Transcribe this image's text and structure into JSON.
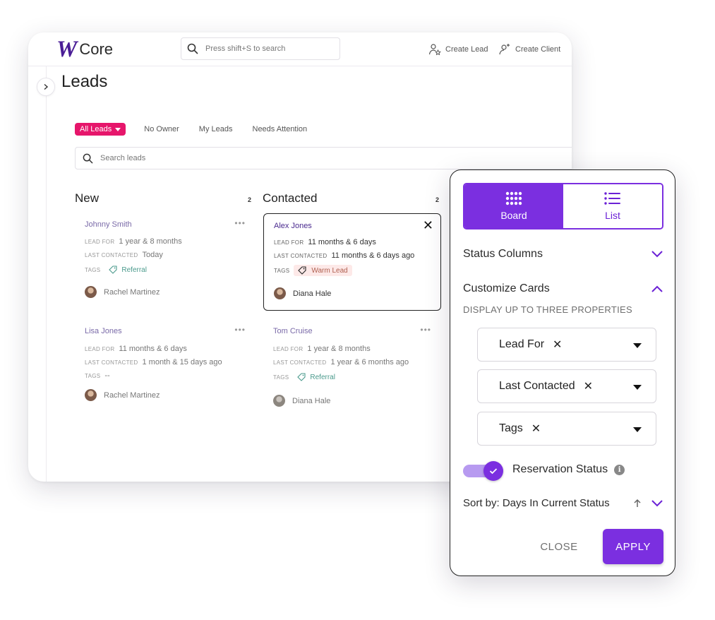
{
  "app": {
    "logo_mark": "W",
    "logo_text": "Core"
  },
  "header": {
    "search_placeholder": "Press shift+S to search",
    "create_lead": "Create Lead",
    "create_client": "Create Client"
  },
  "page": {
    "title": "Leads"
  },
  "filters": {
    "tabs": [
      "All Leads",
      "No Owner",
      "My Leads",
      "Needs Attention"
    ],
    "active": "All Leads"
  },
  "search": {
    "placeholder": "Search leads"
  },
  "columns": [
    {
      "title": "New",
      "count": "2",
      "cards": [
        {
          "name": "Johnny Smith",
          "lead_for_label": "LEAD FOR",
          "lead_for": "1 year & 8 months",
          "last_contacted_label": "LAST CONTACTED",
          "last_contacted": "Today",
          "tags_label": "TAGS",
          "tag": "Referral",
          "owner": "Rachel Martinez"
        },
        {
          "name": "Lisa Jones",
          "lead_for_label": "LEAD FOR",
          "lead_for": "11 months & 6 days",
          "last_contacted_label": "LAST CONTACTED",
          "last_contacted": "1 month & 15 days ago",
          "tags_label": "TAGS",
          "tag": "--",
          "owner": "Rachel Martinez"
        }
      ]
    },
    {
      "title": "Contacted",
      "count": "2",
      "cards": [
        {
          "name": "Alex Jones",
          "lead_for_label": "LEAD FOR",
          "lead_for": "11 months & 6 days",
          "last_contacted_label": "LAST CONTACTED",
          "last_contacted": "11 months & 6 days ago",
          "tags_label": "TAGS",
          "tag": "Warm Lead",
          "owner": "Diana Hale"
        },
        {
          "name": "Tom Cruise",
          "lead_for_label": "LEAD FOR",
          "lead_for": "1 year & 8 months",
          "last_contacted_label": "LAST CONTACTED",
          "last_contacted": "1 year & 6 months ago",
          "tags_label": "TAGS",
          "tag": "Referral",
          "owner": "Diana Hale"
        }
      ]
    }
  ],
  "panel": {
    "view_board": "Board",
    "view_list": "List",
    "status_columns": "Status Columns",
    "customize_cards": "Customize Cards",
    "display_hint": "DISPLAY UP TO THREE PROPERTIES",
    "properties": [
      "Lead For",
      "Last Contacted",
      "Tags"
    ],
    "reservation_status": "Reservation Status",
    "reservation_enabled": true,
    "sort_by": "Sort by: Days In Current Status",
    "close": "CLOSE",
    "apply": "APPLY"
  },
  "colors": {
    "accent": "#7b2fe0",
    "pink": "#e6166b",
    "brand": "#4a1d96"
  },
  "icons": [
    "search-icon",
    "create-lead-icon",
    "create-client-icon",
    "chevron-right-icon",
    "board-grid-icon",
    "list-icon",
    "chevron-down-icon",
    "chevron-up-icon",
    "tag-icon",
    "info-icon",
    "arrow-up-icon",
    "check-icon"
  ]
}
